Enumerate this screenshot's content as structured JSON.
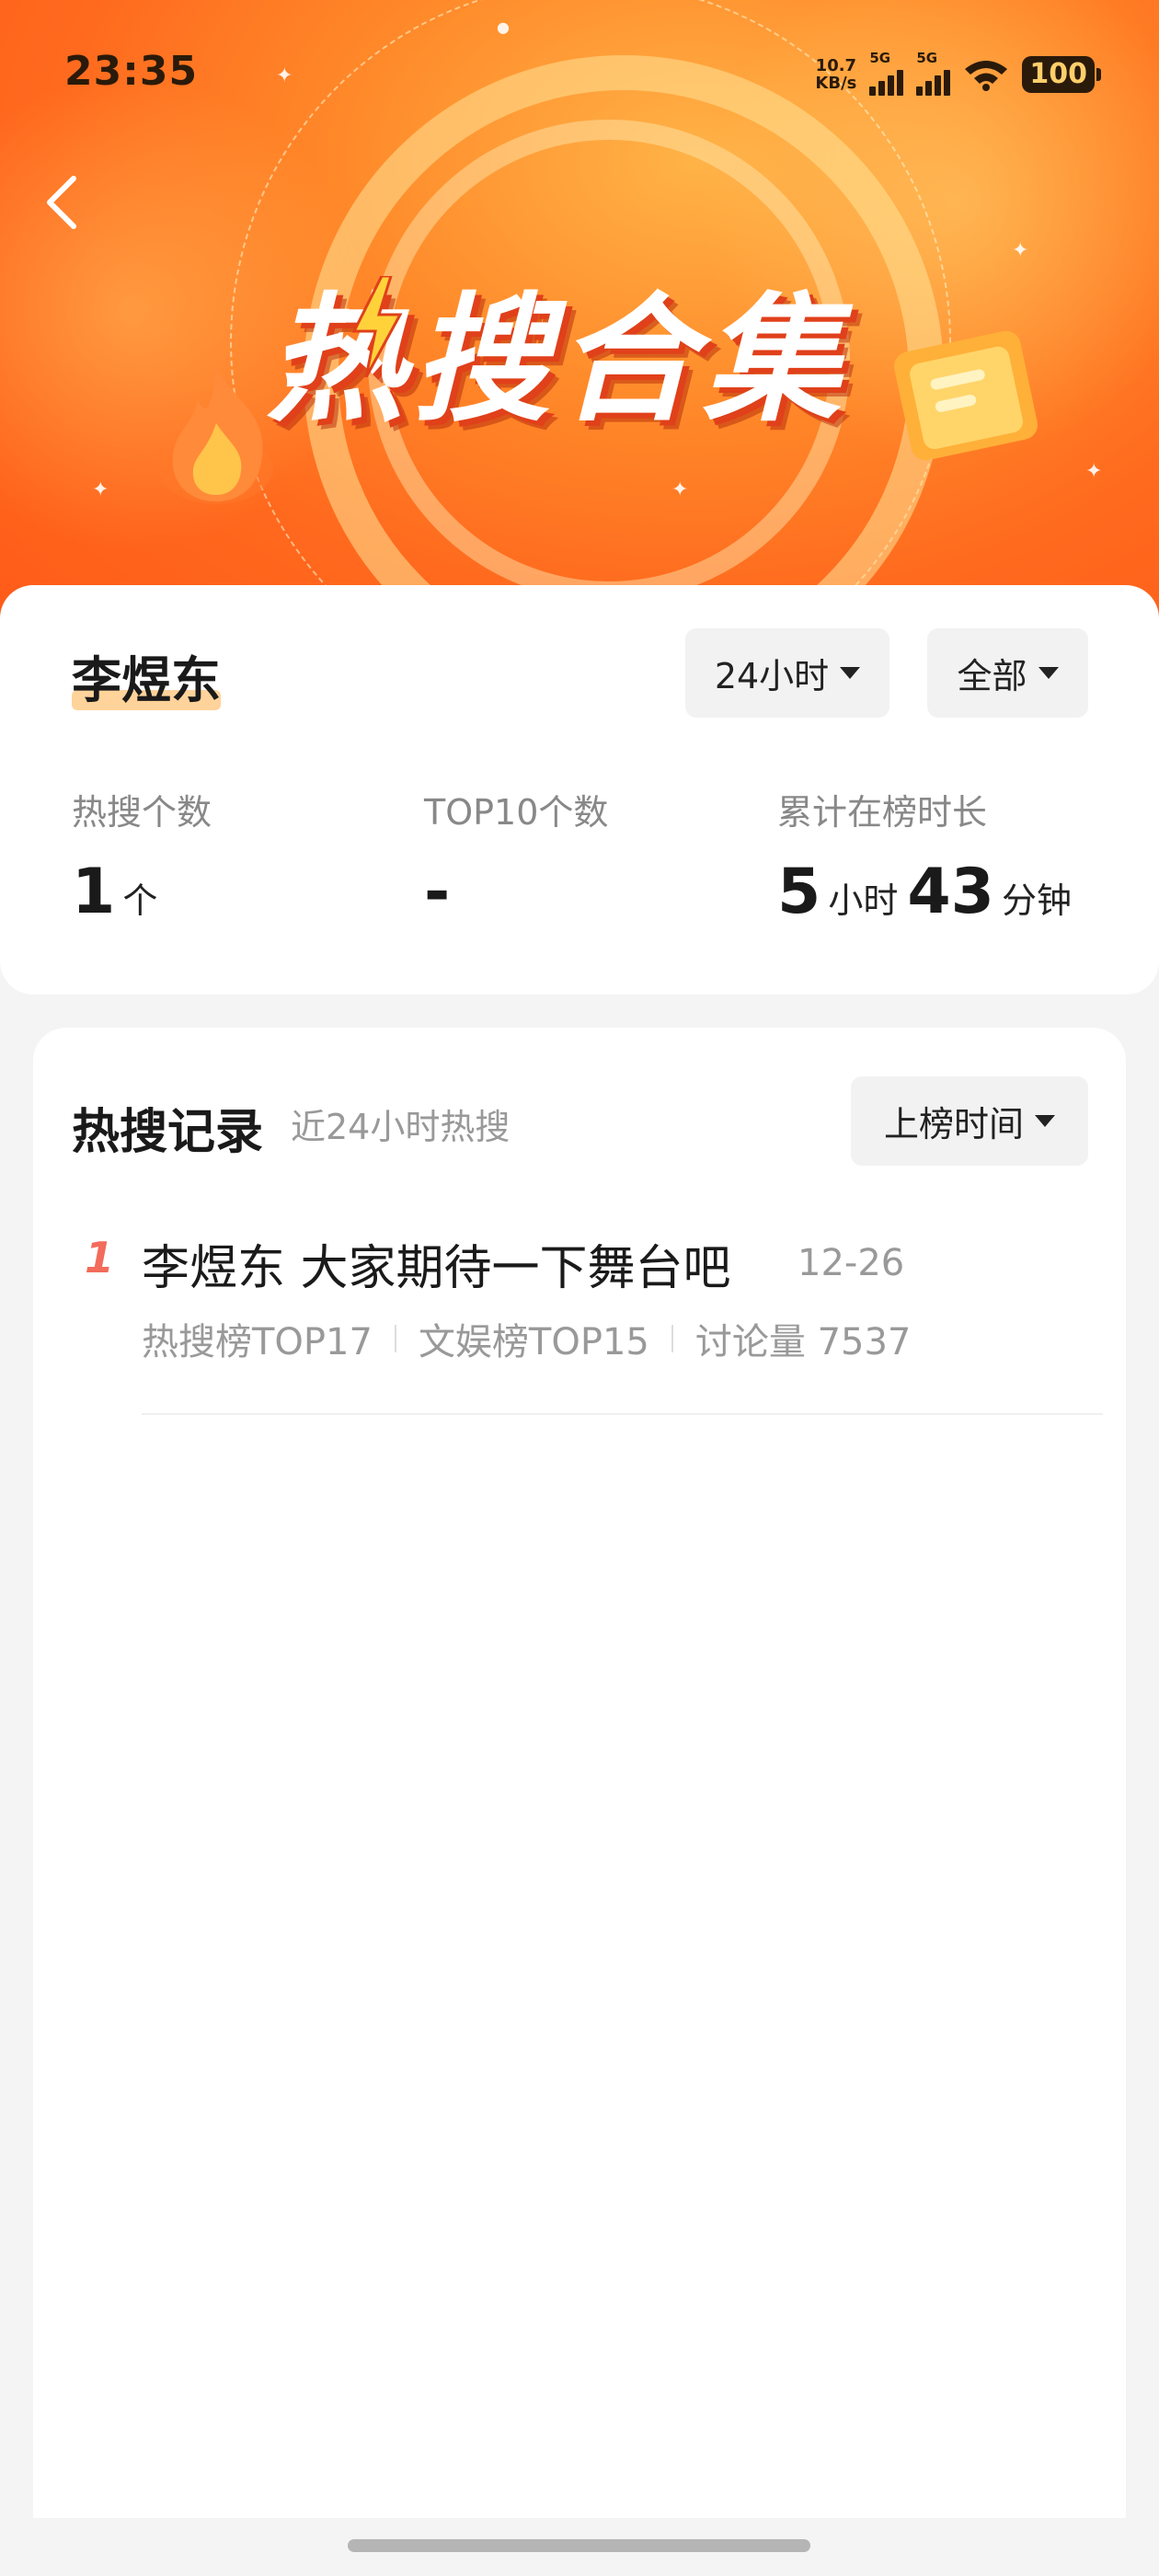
{
  "status_bar": {
    "time": "23:35",
    "net_speed_value": "10.7",
    "net_speed_unit": "KB/s",
    "signal1_label": "5G",
    "signal2_label": "5G",
    "battery": "100"
  },
  "banner": {
    "title": "热搜合集"
  },
  "profile": {
    "name": "李煜东",
    "time_filter": "24小时",
    "scope_filter": "全部"
  },
  "stats": {
    "hot_count_label": "热搜个数",
    "hot_count_value": "1",
    "hot_count_unit": "个",
    "top10_label": "TOP10个数",
    "top10_value": "-",
    "duration_label": "累计在榜时长",
    "duration_hours": "5",
    "duration_hours_unit": "小时",
    "duration_minutes": "43",
    "duration_minutes_unit": "分钟"
  },
  "records": {
    "title": "热搜记录",
    "subtitle": "近24小时热搜",
    "sort_label": "上榜时间",
    "items": [
      {
        "rank": "1",
        "title": "李煜东 大家期待一下舞台吧",
        "date": "12-26",
        "meta1": "热搜榜TOP17",
        "meta2": "文娱榜TOP15",
        "meta3": "讨论量 7537"
      }
    ]
  },
  "colors": {
    "accent_orange": "#ff6a1e",
    "rank_red": "#f26b5b",
    "name_highlight": "#ffd39a"
  }
}
